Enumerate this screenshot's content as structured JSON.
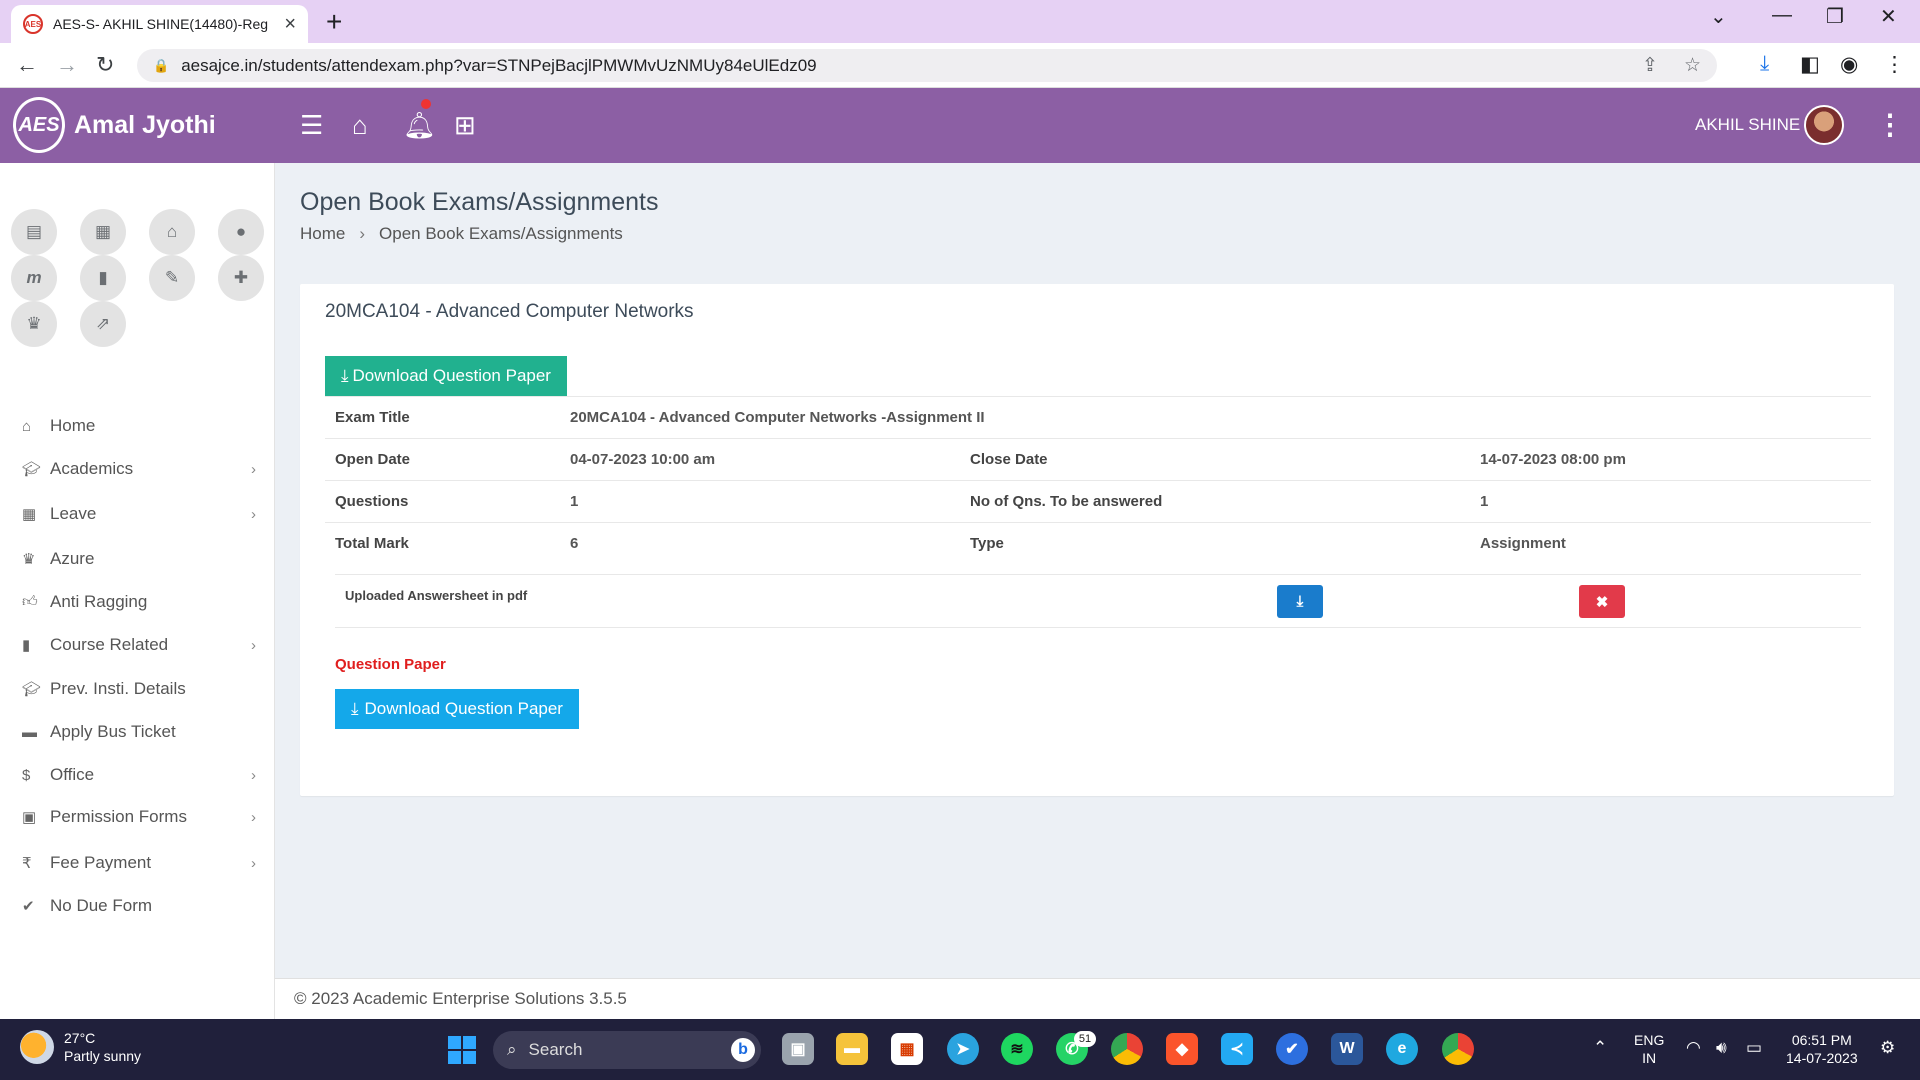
{
  "browser": {
    "tab_title": "AES-S- AKHIL SHINE(14480)-Reg",
    "favicon_text": "AES",
    "url": "aesajce.in/students/attendexam.php?var=STNPejBacjlPMWMvUzNMUy84eUlEdz09"
  },
  "header": {
    "logo_text": "AES",
    "brand": "Amal Jyothi",
    "user_name": "AKHIL SHINE"
  },
  "sidebar": {
    "items": [
      {
        "label": "Home",
        "icon": "home-icon",
        "has_arrow": false
      },
      {
        "label": "Academics",
        "icon": "graduation-cap-icon",
        "has_arrow": true
      },
      {
        "label": "Leave",
        "icon": "calendar-icon",
        "has_arrow": true
      },
      {
        "label": "Azure",
        "icon": "crown-icon",
        "has_arrow": false
      },
      {
        "label": "Anti Ragging",
        "icon": "thumbs-up-icon",
        "has_arrow": false
      },
      {
        "label": "Course Related",
        "icon": "book-icon",
        "has_arrow": true
      },
      {
        "label": "Prev. Insti. Details",
        "icon": "graduation-cap-icon",
        "has_arrow": false
      },
      {
        "label": "Apply Bus Ticket",
        "icon": "bus-icon",
        "has_arrow": false
      },
      {
        "label": "Office",
        "icon": "dollar-icon",
        "has_arrow": true
      },
      {
        "label": "Permission Forms",
        "icon": "lock-icon",
        "has_arrow": true
      },
      {
        "label": "Fee Payment",
        "icon": "rupee-icon",
        "has_arrow": true
      },
      {
        "label": "No Due Form",
        "icon": "check-icon",
        "has_arrow": false
      }
    ]
  },
  "page": {
    "title": "Open Book Exams/Assignments",
    "breadcrumb": [
      "Home",
      "Open Book Exams/Assignments"
    ]
  },
  "exam": {
    "course_title": "20MCA104 - Advanced Computer Networks",
    "download_top_label": "Download Question Paper",
    "rows": [
      {
        "l1": "Exam Title",
        "v1": "20MCA104 - Advanced Computer Networks -Assignment II",
        "l2": "",
        "v2": ""
      },
      {
        "l1": "Open Date",
        "v1": "04-07-2023 10:00 am",
        "l2": "Close Date",
        "v2": "14-07-2023 08:00 pm"
      },
      {
        "l1": "Questions",
        "v1": "1",
        "l2": "No of Qns. To be answered",
        "v2": "1"
      },
      {
        "l1": "Total Mark",
        "v1": "6",
        "l2": "Type",
        "v2": "Assignment"
      }
    ],
    "upload_label": "Uploaded Answersheet in pdf",
    "question_paper_label": "Question Paper",
    "download_bottom_label": "Download Question Paper",
    "colors": {
      "green": "#21b18f",
      "blue": "#14a8ea",
      "download": "#1a7ccc",
      "delete": "#e23a4a"
    }
  },
  "footer": {
    "text": "© 2023 Academic Enterprise Solutions 3.5.5"
  },
  "taskbar": {
    "temperature": "27°C",
    "weather": "Partly sunny",
    "search_placeholder": "Search",
    "whatsapp_badge": "51",
    "lang_top": "ENG",
    "lang_bottom": "IN",
    "time": "06:51 PM",
    "date": "14-07-2023"
  }
}
